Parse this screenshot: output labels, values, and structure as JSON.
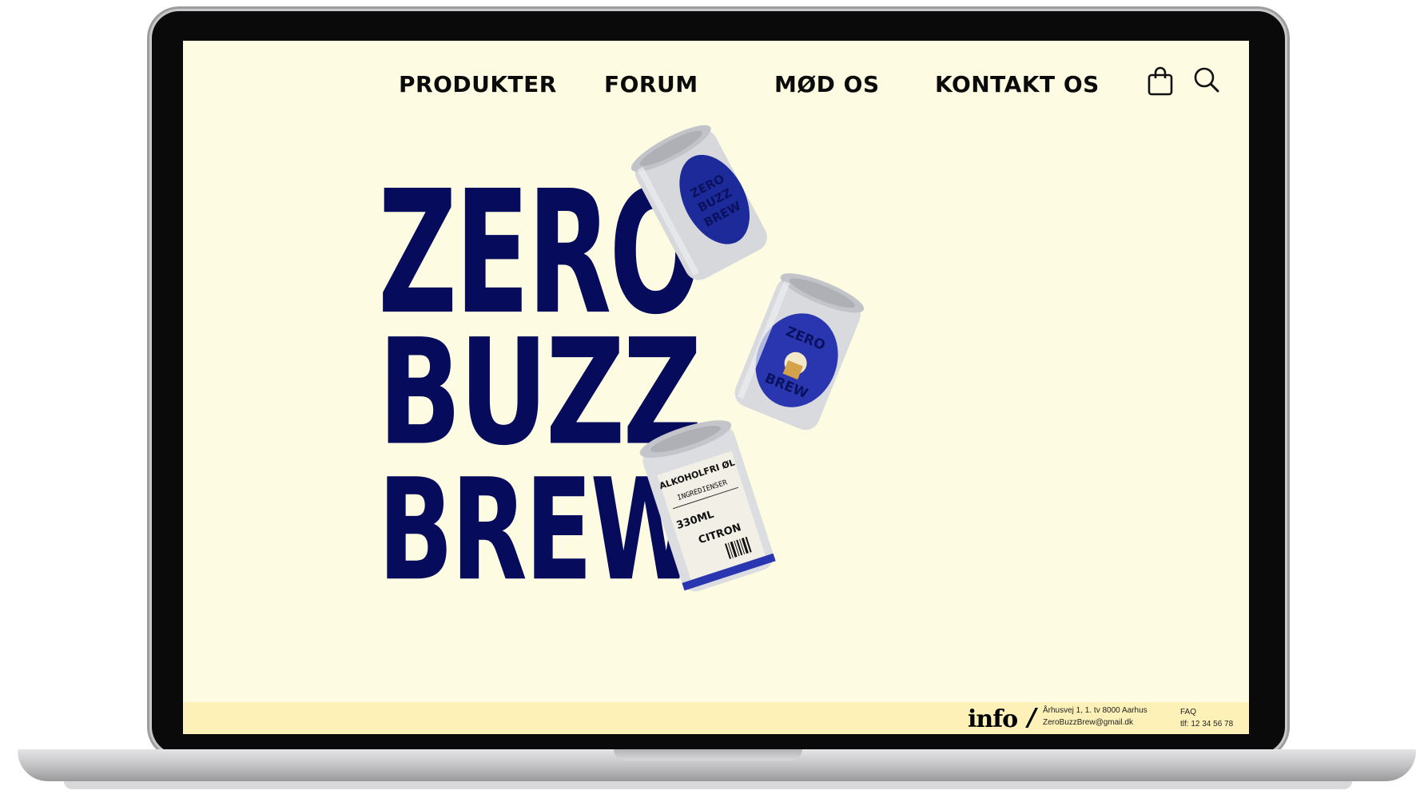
{
  "nav": {
    "items": [
      "PRODUKTER",
      "FORUM",
      "MØD OS",
      "KONTAKT OS"
    ],
    "cart_icon": "shopping-bag-icon",
    "search_icon": "search-icon"
  },
  "hero": {
    "logo_lines": [
      "ZERO",
      "BUZZ",
      "BREW"
    ],
    "can_top_label": "ZERO BUZZ BREW",
    "can_back_label": "ALKOHOLFRI ØL",
    "can_back_ingredients": "INGREDIENSER",
    "can_back_volume": "330ML",
    "can_back_flavor": "CITRON"
  },
  "footer": {
    "info_label": "info",
    "separator": "/",
    "address": "Århusvej 1, 1. tv 8000 Aarhus",
    "email": "ZeroBuzzBrew@gmail.dk",
    "faq": "FAQ",
    "phone": "tlf: 12 34 56 78"
  },
  "colors": {
    "page_background": "#fdfbe2",
    "footer_background": "#fdf1b8",
    "brand_navy": "#060b5c",
    "text": "#0b0b0b"
  }
}
